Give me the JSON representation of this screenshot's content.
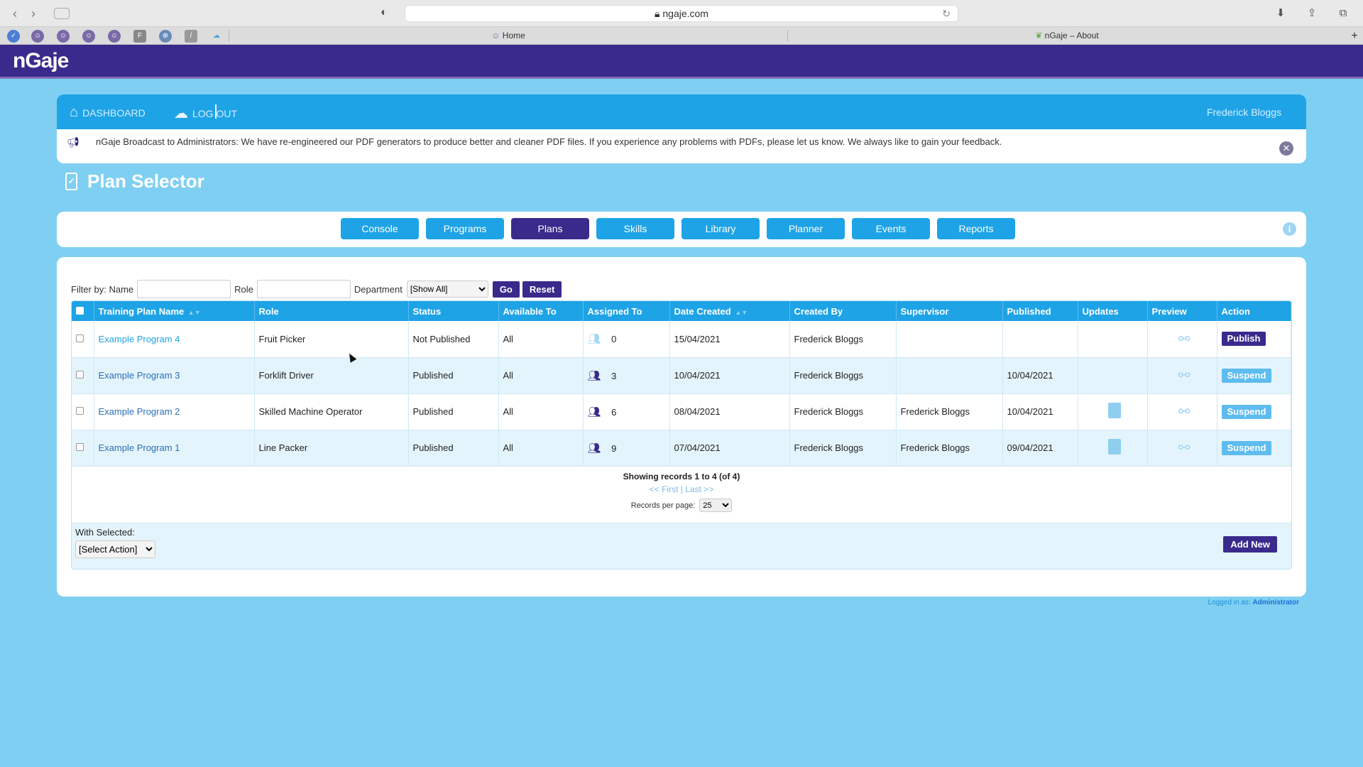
{
  "browser": {
    "url": "ngaje.com",
    "tabs": [
      {
        "label": "Home"
      },
      {
        "label": "nGaje – About"
      }
    ]
  },
  "app": {
    "logo": "nGaje"
  },
  "nav": {
    "dashboard": "DASHBOARD",
    "logout": "LOG OUT",
    "user": "Frederick Bloggs"
  },
  "broadcast": {
    "message": "nGaje Broadcast to Administrators: We have re-engineered our PDF generators to produce better and cleaner PDF files. If you experience any problems with PDFs, please let us know. We always like to gain your feedback."
  },
  "page": {
    "title": "Plan Selector"
  },
  "modules": [
    {
      "label": "Console",
      "active": false
    },
    {
      "label": "Programs",
      "active": false
    },
    {
      "label": "Plans",
      "active": true
    },
    {
      "label": "Skills",
      "active": false
    },
    {
      "label": "Library",
      "active": false
    },
    {
      "label": "Planner",
      "active": false
    },
    {
      "label": "Events",
      "active": false
    },
    {
      "label": "Reports",
      "active": false
    }
  ],
  "filter": {
    "label": "Filter by: Name",
    "role_label": "Role",
    "department_label": "Department",
    "department_value": "[Show All]",
    "go": "Go",
    "reset": "Reset"
  },
  "table": {
    "headers": [
      "Training Plan Name",
      "Role",
      "Status",
      "Available To",
      "Assigned To",
      "Date Created",
      "Created By",
      "Supervisor",
      "Published",
      "Updates",
      "Preview",
      "Action"
    ],
    "rows": [
      {
        "name": "Example Program 4",
        "role": "Fruit Picker",
        "status": "Not Published",
        "available": "All",
        "assigned": "0",
        "date_created": "15/04/2021",
        "created_by": "Frederick Bloggs",
        "supervisor": "",
        "published": "",
        "has_update": false,
        "action": "Publish"
      },
      {
        "name": "Example Program 3",
        "role": "Forklift Driver",
        "status": "Published",
        "available": "All",
        "assigned": "3",
        "date_created": "10/04/2021",
        "created_by": "Frederick Bloggs",
        "supervisor": "",
        "published": "10/04/2021",
        "has_update": false,
        "action": "Suspend"
      },
      {
        "name": "Example Program 2",
        "role": "Skilled Machine Operator",
        "status": "Published",
        "available": "All",
        "assigned": "6",
        "date_created": "08/04/2021",
        "created_by": "Frederick Bloggs",
        "supervisor": "Frederick Bloggs",
        "published": "10/04/2021",
        "has_update": true,
        "action": "Suspend"
      },
      {
        "name": "Example Program 1",
        "role": "Line Packer",
        "status": "Published",
        "available": "All",
        "assigned": "9",
        "date_created": "07/04/2021",
        "created_by": "Frederick Bloggs",
        "supervisor": "Frederick Bloggs",
        "published": "09/04/2021",
        "has_update": true,
        "action": "Suspend"
      }
    ]
  },
  "pager": {
    "showing": "Showing records 1 to 4 (of 4)",
    "first": "<< First",
    "sep": "|",
    "last": "Last >>",
    "rpp_label": "Records per page:",
    "rpp_value": "25"
  },
  "bulk": {
    "label": "With Selected:",
    "select_value": "[Select Action]",
    "add_new": "Add New"
  },
  "footer": {
    "logged_in_label": "Logged in as:",
    "role": "Administrator"
  }
}
